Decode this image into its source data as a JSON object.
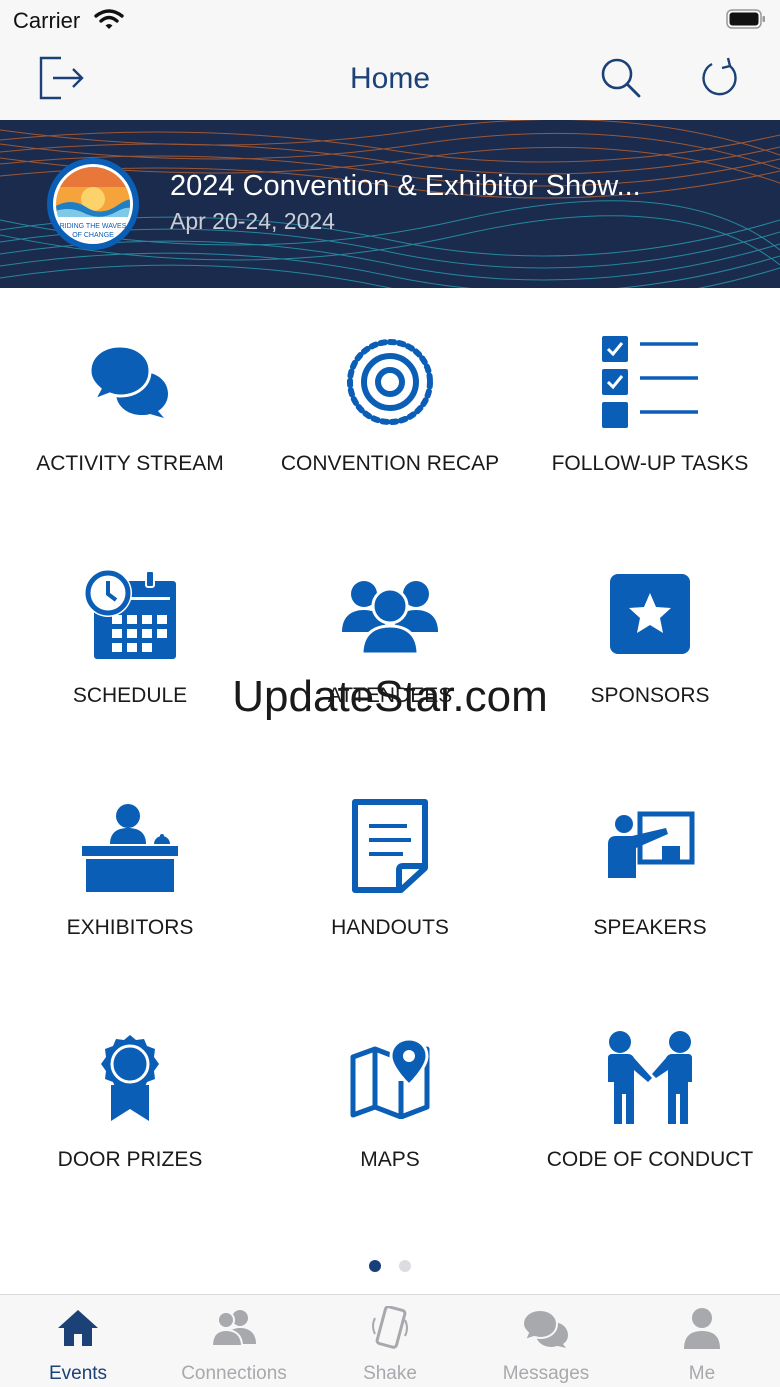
{
  "status_bar": {
    "carrier": "Carrier"
  },
  "nav": {
    "title": "Home"
  },
  "event": {
    "title": "2024 Convention & Exhibitor Show...",
    "date": "Apr 20-24, 2024",
    "logo_text": "RIDING THE WAVES OF CHANGE"
  },
  "grid": {
    "items": [
      {
        "label": "ACTIVITY STREAM",
        "icon": "chat-bubbles-icon"
      },
      {
        "label": "CONVENTION RECAP",
        "icon": "target-icon"
      },
      {
        "label": "FOLLOW-UP TASKS",
        "icon": "checklist-icon"
      },
      {
        "label": "SCHEDULE",
        "icon": "calendar-clock-icon"
      },
      {
        "label": "ATTENDEES",
        "icon": "people-group-icon"
      },
      {
        "label": "SPONSORS",
        "icon": "star-icon"
      },
      {
        "label": "EXHIBITORS",
        "icon": "reception-desk-icon"
      },
      {
        "label": "HANDOUTS",
        "icon": "document-icon"
      },
      {
        "label": "SPEAKERS",
        "icon": "presenter-icon"
      },
      {
        "label": "DOOR PRIZES",
        "icon": "award-ribbon-icon"
      },
      {
        "label": "MAPS",
        "icon": "map-pin-icon"
      },
      {
        "label": "CODE OF CONDUCT",
        "icon": "handshake-people-icon"
      }
    ]
  },
  "watermark": "UpdateStar.com",
  "pager": {
    "current": 1,
    "total": 2
  },
  "tabs": [
    {
      "label": "Events",
      "icon": "home-icon",
      "active": true
    },
    {
      "label": "Connections",
      "icon": "connections-icon",
      "active": false
    },
    {
      "label": "Shake",
      "icon": "phone-shake-icon",
      "active": false
    },
    {
      "label": "Messages",
      "icon": "messages-icon",
      "active": false
    },
    {
      "label": "Me",
      "icon": "person-icon",
      "active": false
    }
  ],
  "colors": {
    "accent": "#0a5eb5",
    "nav_title": "#1b4177",
    "tab_inactive": "#a7a9ad"
  }
}
